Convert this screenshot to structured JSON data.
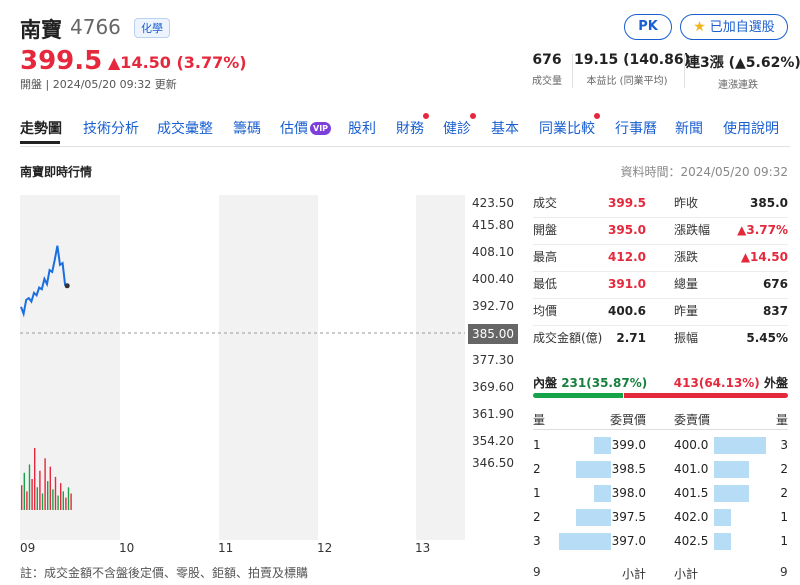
{
  "stock": {
    "name": "南寶",
    "code": "4766",
    "category": "化學",
    "price": "399.5",
    "change": "▲14.50 (3.77%)",
    "open_time": "開盤 | 2024/05/20 09:32 更新"
  },
  "header_buttons": {
    "pk": "PK",
    "watchlist": "已加自選股",
    "watchlist_icon": "star-icon"
  },
  "stats": [
    {
      "value": "676",
      "label": "成交量"
    },
    {
      "value": "19.15 (140.86)",
      "label": "本益比 (同業平均)"
    },
    {
      "value": "連3漲 (▲5.62%)",
      "label": "連漲連跌"
    }
  ],
  "tabs": [
    {
      "label": "走勢圖",
      "active": true,
      "dot": false
    },
    {
      "label": "技術分析",
      "dot": false
    },
    {
      "label": "成交彙整",
      "dot": false
    },
    {
      "label": "籌碼",
      "dot": false
    },
    {
      "label": "估價",
      "dot": false,
      "badge": "VIP"
    },
    {
      "label": "股利",
      "dot": false
    },
    {
      "label": "財務",
      "dot": true
    },
    {
      "label": "健診",
      "dot": true
    },
    {
      "label": "基本",
      "dot": false
    },
    {
      "label": "同業比較",
      "dot": true
    },
    {
      "label": "行事曆",
      "dot": false
    },
    {
      "label": "新聞",
      "dot": false
    },
    {
      "label": "使用說明",
      "dot": false
    }
  ],
  "section_title": "南寶即時行情",
  "data_time": "資料時間：2024/05/20 09:32",
  "chart_data": {
    "type": "line",
    "title": "",
    "xlabel": "",
    "ylabel": "",
    "x_ticks": [
      "09",
      "10",
      "11",
      "12",
      "13"
    ],
    "y_ticks": [
      "423.50",
      "415.80",
      "408.10",
      "400.40",
      "392.70",
      "385.00",
      "377.30",
      "369.60",
      "361.90",
      "354.20",
      "346.50"
    ],
    "ylim": [
      346.5,
      423.5
    ],
    "reference_price": "385.00",
    "price_series": [
      393.5,
      391.5,
      395.5,
      396.0,
      395.0,
      397.5,
      396.8,
      399.0,
      398.5,
      401.5,
      400.0,
      404.0,
      403.5,
      407.0,
      411.0,
      405.5,
      406.0,
      399.5
    ],
    "volume_series": [
      12,
      18,
      9,
      22,
      15,
      30,
      11,
      19,
      8,
      25,
      14,
      21,
      10,
      16,
      7,
      13,
      9,
      6,
      11,
      8
    ],
    "volume_colors": [
      "#e5283c",
      "#16a34a",
      "#e5283c",
      "#16a34a",
      "#e5283c",
      "#e5283c",
      "#16a34a",
      "#e5283c",
      "#16a34a",
      "#e5283c",
      "#16a34a",
      "#e5283c",
      "#16a34a",
      "#e5283c",
      "#16a34a",
      "#e5283c",
      "#16a34a",
      "#e5283c",
      "#16a34a",
      "#e5283c"
    ]
  },
  "note": "註：成交金額不含盤後定價、零股、鉅額、拍賣及標購",
  "summary_left": [
    {
      "label": "成交",
      "value": "399.5",
      "color": "#e5283c"
    },
    {
      "label": "開盤",
      "value": "395.0",
      "color": "#e5283c"
    },
    {
      "label": "最高",
      "value": "412.0",
      "color": "#e5283c"
    },
    {
      "label": "最低",
      "value": "391.0",
      "color": "#e5283c"
    },
    {
      "label": "均價",
      "value": "400.6",
      "color": "#222222"
    },
    {
      "label": "成交金額(億)",
      "value": "2.71",
      "color": "#222222"
    }
  ],
  "summary_right": [
    {
      "label": "昨收",
      "value": "385.0",
      "color": "#222222"
    },
    {
      "label": "漲跌幅",
      "value": "▲3.77%",
      "color": "#e5283c"
    },
    {
      "label": "漲跌",
      "value": "▲14.50",
      "color": "#e5283c"
    },
    {
      "label": "總量",
      "value": "676",
      "color": "#222222"
    },
    {
      "label": "昨量",
      "value": "837",
      "color": "#222222"
    },
    {
      "label": "振幅",
      "value": "5.45%",
      "color": "#222222"
    }
  ],
  "inner_outer": {
    "inner_label": "內盤",
    "inner_value": "231(35.87%)",
    "outer_value": "413(64.13%)",
    "outer_label": "外盤",
    "inner_fraction": 0.3587
  },
  "orderbook": {
    "bid_qty_header": "量",
    "bid_price_header": "委買價",
    "ask_price_header": "委賣價",
    "ask_qty_header": "量",
    "bids": [
      {
        "qty": "1",
        "price": "399.0",
        "fill": 0.33
      },
      {
        "qty": "2",
        "price": "398.5",
        "fill": 0.67
      },
      {
        "qty": "1",
        "price": "398.0",
        "fill": 0.33
      },
      {
        "qty": "2",
        "price": "397.5",
        "fill": 0.67
      },
      {
        "qty": "3",
        "price": "397.0",
        "fill": 1.0
      }
    ],
    "asks": [
      {
        "price": "400.0",
        "qty": "3",
        "fill": 1.0
      },
      {
        "price": "401.0",
        "qty": "2",
        "fill": 0.67
      },
      {
        "price": "401.5",
        "qty": "2",
        "fill": 0.67
      },
      {
        "price": "402.0",
        "qty": "1",
        "fill": 0.33
      },
      {
        "price": "402.5",
        "qty": "1",
        "fill": 0.33
      }
    ],
    "bid_total_qty": "9",
    "bid_total_label": "小計",
    "ask_total_label": "小計",
    "ask_total_qty": "9"
  }
}
